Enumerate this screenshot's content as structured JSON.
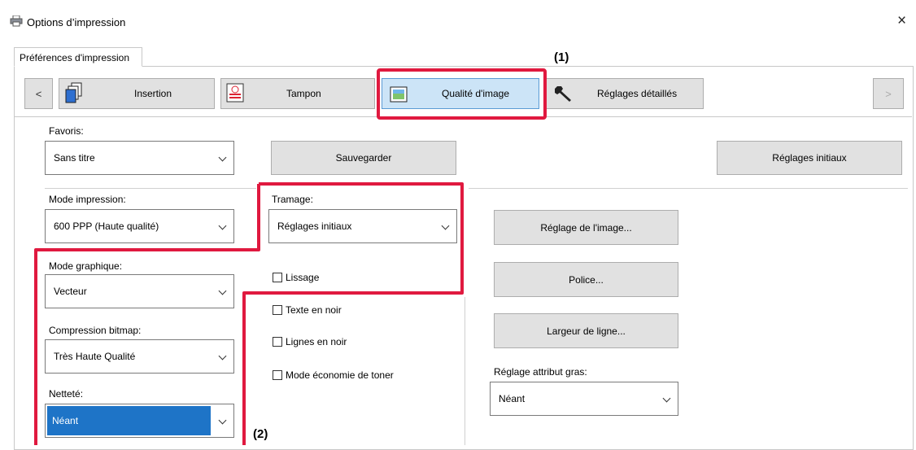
{
  "window": {
    "title": "Options d’impression",
    "close_glyph": "×"
  },
  "tab": {
    "label": "Préférences d'impression"
  },
  "ribbon": {
    "prev_glyph": "<",
    "next_glyph": ">",
    "buttons": [
      {
        "label": "Insertion",
        "icon": "insertion-icon"
      },
      {
        "label": "Tampon",
        "icon": "stamp-icon"
      },
      {
        "label": "Qualité d'image",
        "icon": "image-quality-icon",
        "selected": true
      },
      {
        "label": "Réglages détaillés",
        "icon": "wrench-icon"
      }
    ]
  },
  "favorites": {
    "label": "Favoris:",
    "value": "Sans titre",
    "save_label": "Sauvegarder",
    "defaults_label": "Réglages initiaux"
  },
  "print_mode": {
    "label": "Mode impression:",
    "value": "600 PPP (Haute qualité)"
  },
  "graphics_mode": {
    "label": "Mode graphique:",
    "value": "Vecteur"
  },
  "bitmap_compression": {
    "label": "Compression bitmap:",
    "value": "Très Haute Qualité"
  },
  "sharpness": {
    "label": "Netteté:",
    "value": "Néant"
  },
  "screening": {
    "label": "Tramage:",
    "value": "Réglages initiaux"
  },
  "checkboxes": {
    "smoothing": "Lissage",
    "black_text": "Texte en noir",
    "black_lines": "Lignes en noir",
    "toner_save": "Mode économie de toner"
  },
  "buttons": {
    "image_adjust": "Réglage de l'image...",
    "font": "Police...",
    "line_width": "Largeur de ligne..."
  },
  "bold_attr": {
    "label": "Réglage attribut gras:",
    "value": "Néant"
  },
  "callouts": {
    "one": "(1)",
    "two": "(2)"
  },
  "colors": {
    "highlight": "#e0193f",
    "selected_tab": "#cce4f7",
    "selection": "#1e74c7"
  }
}
